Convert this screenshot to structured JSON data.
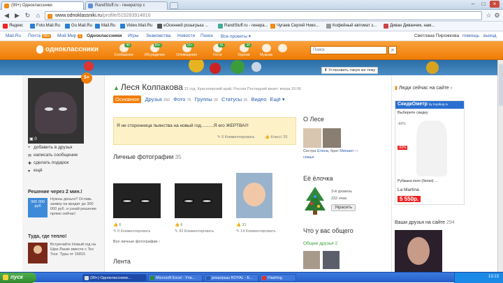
{
  "browser": {
    "tabs": [
      {
        "label": "(99+) Одноклассники",
        "active": true
      },
      {
        "label": "RandStuff.ru - генератор с",
        "active": false
      }
    ],
    "url_prefix": "www.odnoklassniki.ru",
    "url_path": "/profile/515283914816",
    "bookmarks": [
      "Яндекс",
      "Foto.Mail.Ru",
      "Go.Mail.Ru",
      "Mail.Ru",
      "Video.Mail.Ru",
      "eОсенний розыгрыш ...",
      "RandStuff.ru - генера...",
      "Чугаев Сергей Нико...",
      "Кофейный автомат з...",
      "Диван Диванчик, нам..."
    ]
  },
  "mailru": {
    "items": [
      "Mail.Ru",
      "Почта",
      "Мой Мир",
      "Одноклассники",
      "Игры",
      "Знакомства",
      "Новости",
      "Поиск",
      "Все проекты ▾"
    ],
    "mail_badge": "99+",
    "mir_badge": "1",
    "user_name": "Светлана Пирожкова",
    "help": "помощь",
    "exit": "выход"
  },
  "ok": {
    "logo": "одноклассники",
    "nav": [
      {
        "label": "Сообщения",
        "badge": "46"
      },
      {
        "label": "Обсуждения",
        "badge": "99+"
      },
      {
        "label": "Оповещения",
        "badge": "16+"
      },
      {
        "label": "Гости",
        "badge": "41"
      },
      {
        "label": "Оценки",
        "badge": "36"
      },
      {
        "label": "Музыка",
        "badge": ""
      },
      {
        "label": "",
        "badge": ""
      }
    ],
    "search_placeholder": "Поиск",
    "banner_link": "Установить такую же тему"
  },
  "profile": {
    "name": "Леся Колпакова",
    "info": "31 год, Красноярский край, Россия  Последний визит: вчера 15:06",
    "badge": "5+",
    "tabs": [
      {
        "label": "Основное",
        "count": ""
      },
      {
        "label": "Друзья",
        "count": "250"
      },
      {
        "label": "Фото",
        "count": "75"
      },
      {
        "label": "Группы",
        "count": "20"
      },
      {
        "label": "Статусы",
        "count": "25"
      },
      {
        "label": "Видео",
        "count": ""
      },
      {
        "label": "Ещё ▾",
        "count": ""
      }
    ],
    "status_text": "Я не сторонница пьянства на новый год..........Я его ЖЕРТВА!!!",
    "status_comments": "0 Комментировать",
    "status_likes": "Класс! 25",
    "photos_title": "Личные фотографии",
    "photos_count": "35",
    "photos": [
      {
        "likes": "6",
        "comments": "0 Комментировать"
      },
      {
        "likes": "6",
        "comments": "93 Комментировать"
      },
      {
        "likes": "31",
        "comments": "14 Комментировать"
      }
    ],
    "all_photos": "Все личные фотографии ›",
    "feed_title": "Лента",
    "photo_count_small": "0"
  },
  "left_actions": [
    "добавить в друзья",
    "написать сообщение",
    "сделать подарок",
    "ещё"
  ],
  "ads": {
    "ad1_title": "Решение через 2 мин.!",
    "ad1_badge": "300 000 руб",
    "ad1_text": "Нужны деньги? Оставь заявку на кредит до 300 000 руб. и узнай решение прямо сейчас!",
    "ad2_title": "Туда, где тепло!",
    "ad2_text": "Встречайте Новый год на Шри-Ланке вместе с Tez Tour. Туры от 16815"
  },
  "about": {
    "title": "О Лесе",
    "sister_label": "Сестра",
    "sister": "Елена",
    "brother_label": ", брат",
    "brother": "Михаил",
    "family": "семья"
  },
  "tree": {
    "title": "Её ёлочка",
    "level": "3-й уровень",
    "points": "232 очка",
    "button": "Украсить"
  },
  "common": {
    "title": "Что у вас общего",
    "friends": "Общие друзья 2"
  },
  "right": {
    "online_title": "Люди сейчас на сайте ›",
    "ad_brand": "СкидкОметр",
    "ad_by": "by Kupikup.ru",
    "ad_choose": "Выберите скидку",
    "ad_pct1": "-80%",
    "ad_pct2": "-50%",
    "ad_item": "Рубашка поло (белая) ...",
    "ad_shop": "La Martina",
    "ad_price": "5 550р.",
    "friends_title": "Ваши друзья на сайте",
    "friends_count": "294"
  },
  "taskbar": {
    "start": "пуск",
    "items": [
      "(99+) Одноклассники...",
      "Microsoft Excel - Уча...",
      "розыгрыш ROYAL - Б...",
      "Flashing"
    ],
    "time": "13:13"
  }
}
